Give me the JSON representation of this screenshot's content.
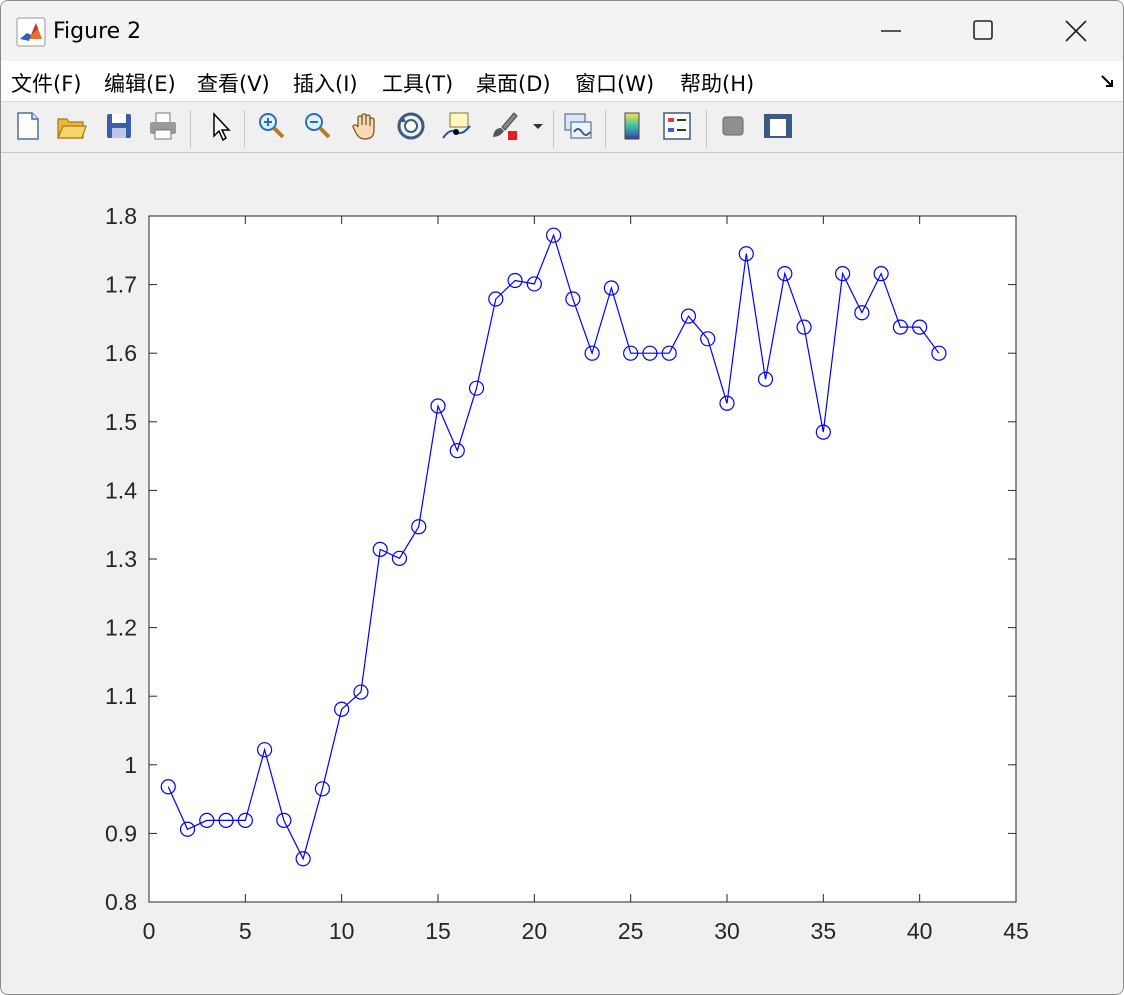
{
  "window": {
    "title": "Figure 2"
  },
  "menu": [
    {
      "label": "文件(F)"
    },
    {
      "label": "编辑(E)"
    },
    {
      "label": "查看(V)"
    },
    {
      "label": "插入(I)"
    },
    {
      "label": "工具(T)"
    },
    {
      "label": "桌面(D)"
    },
    {
      "label": "窗口(W)"
    },
    {
      "label": "帮助(H)"
    }
  ],
  "toolbar": [
    {
      "icon": "new-figure-icon"
    },
    {
      "icon": "open-file-icon"
    },
    {
      "icon": "save-icon"
    },
    {
      "icon": "print-icon"
    },
    {
      "icon": "edit-plot-arrow-icon"
    },
    {
      "icon": "zoom-in-icon"
    },
    {
      "icon": "zoom-out-icon"
    },
    {
      "icon": "pan-hand-icon"
    },
    {
      "icon": "rotate-3d-icon"
    },
    {
      "icon": "data-cursor-icon"
    },
    {
      "icon": "brush-icon"
    },
    {
      "icon": "link-plot-icon"
    },
    {
      "icon": "colorbar-icon"
    },
    {
      "icon": "legend-icon"
    },
    {
      "icon": "hide-plot-tools-icon"
    },
    {
      "icon": "show-plot-tools-icon"
    }
  ],
  "colors": {
    "line": "#0000ff",
    "axes_bg": "#ffffff",
    "figure_bg": "#f0f0f0"
  },
  "chart_data": {
    "type": "line",
    "marker": "circle",
    "title": "",
    "xlabel": "",
    "ylabel": "",
    "xlim": [
      0,
      45
    ],
    "ylim": [
      0.8,
      1.8
    ],
    "xticks": [
      "0",
      "5",
      "10",
      "15",
      "20",
      "25",
      "30",
      "35",
      "40",
      "45"
    ],
    "yticks": [
      "0.8",
      "0.9",
      "1",
      "1.1",
      "1.2",
      "1.3",
      "1.4",
      "1.5",
      "1.6",
      "1.7",
      "1.8"
    ],
    "grid": false,
    "x": [
      1,
      2,
      3,
      4,
      5,
      6,
      7,
      8,
      9,
      10,
      11,
      12,
      13,
      14,
      15,
      16,
      17,
      18,
      19,
      20,
      21,
      22,
      23,
      24,
      25,
      26,
      27,
      28,
      29,
      30,
      31,
      32,
      33,
      34,
      35,
      36,
      37,
      38,
      39,
      40,
      41
    ],
    "y": [
      0.968,
      0.906,
      0.919,
      0.919,
      0.919,
      1.022,
      0.919,
      0.863,
      0.965,
      1.081,
      1.106,
      1.314,
      1.301,
      1.347,
      1.523,
      1.458,
      1.549,
      1.679,
      1.706,
      1.701,
      1.772,
      1.679,
      1.6,
      1.695,
      1.6,
      1.6,
      1.6,
      1.654,
      1.621,
      1.527,
      1.745,
      1.562,
      1.716,
      1.638,
      1.485,
      1.716,
      1.659,
      1.716,
      1.638,
      1.638,
      1.6
    ]
  }
}
